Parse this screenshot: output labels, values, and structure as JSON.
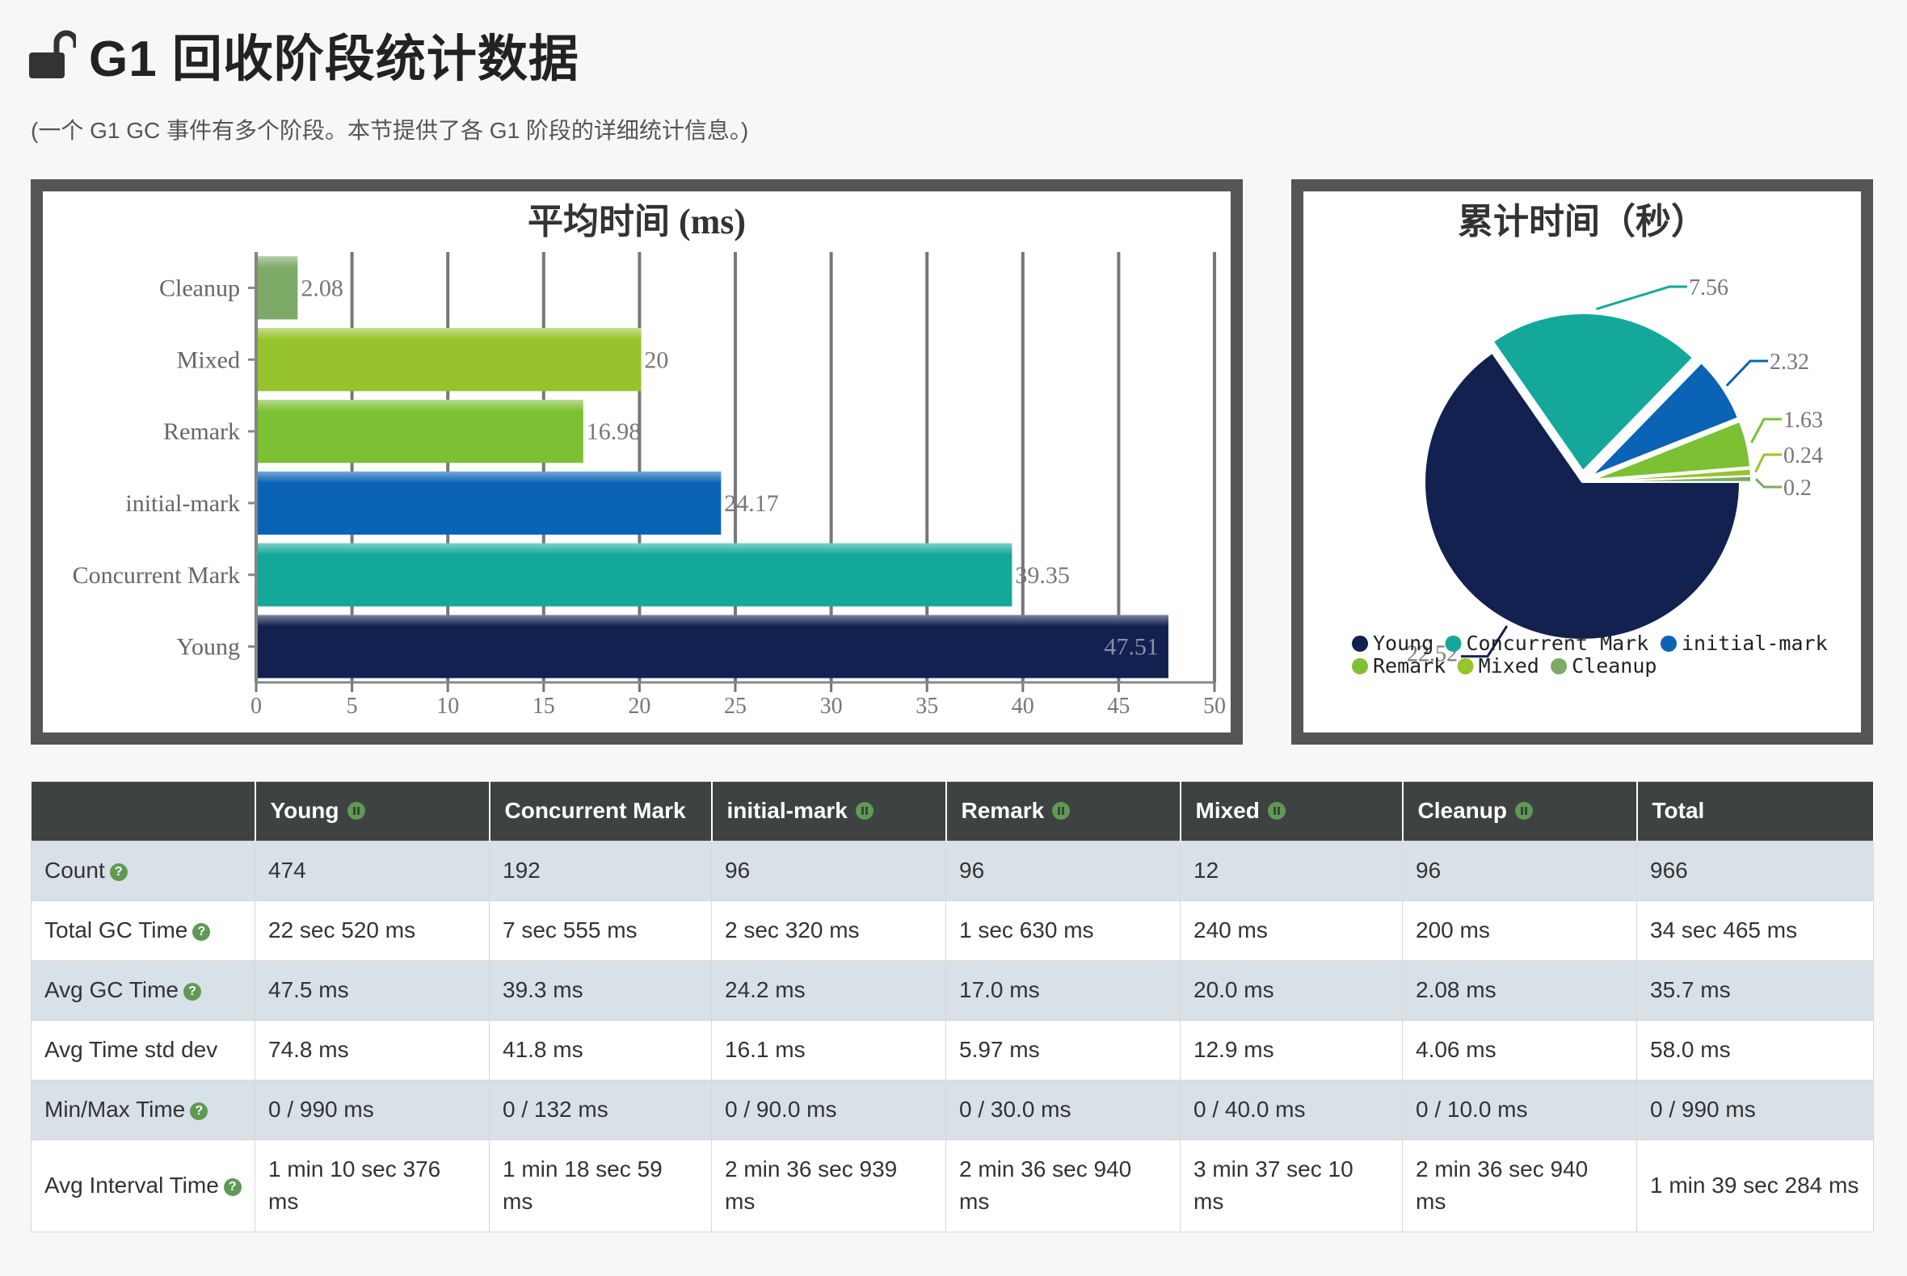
{
  "header": {
    "title": "G1 回收阶段统计数据",
    "subtitle": "(一个 G1 GC 事件有多个阶段。本节提供了各 G1 阶段的详细统计信息。)",
    "icon": "unlock-icon"
  },
  "colors": {
    "young": "#12214f",
    "concurrent_mark": "#14a89b",
    "initial_mark": "#0a63b5",
    "remark": "#7cc034",
    "mixed": "#97c42c",
    "cleanup": "#7daa66",
    "panel_border": "#555555",
    "table_header": "#3e4243"
  },
  "chart_data": [
    {
      "type": "bar",
      "orientation": "horizontal",
      "title": "平均时间 (ms)",
      "categories": [
        "Cleanup",
        "Mixed",
        "Remark",
        "initial-mark",
        "Concurrent Mark",
        "Young"
      ],
      "values": [
        2.08,
        20,
        16.98,
        24.17,
        39.35,
        47.51
      ],
      "value_labels": [
        "2.08",
        "20",
        "16.98",
        "24.17",
        "39.35",
        "47.51"
      ],
      "xlim": [
        0,
        50
      ],
      "xticks": [
        0,
        5,
        10,
        15,
        20,
        25,
        30,
        35,
        40,
        45,
        50
      ],
      "grid": true
    },
    {
      "type": "pie",
      "title": "累计时间（秒）",
      "labels": [
        "Young",
        "Concurrent Mark",
        "initial-mark",
        "Remark",
        "Mixed",
        "Cleanup"
      ],
      "values": [
        22.52,
        7.56,
        2.32,
        1.63,
        0.24,
        0.2
      ],
      "value_labels": [
        "22.52",
        "7.56",
        "2.32",
        "1.63",
        "0.24",
        "0.2"
      ],
      "legend_position": "bottom"
    }
  ],
  "table": {
    "columns": [
      {
        "label": "",
        "icon": ""
      },
      {
        "label": "Young",
        "icon": "pause-icon"
      },
      {
        "label": "Concurrent Mark",
        "icon": ""
      },
      {
        "label": "initial-mark",
        "icon": "pause-icon"
      },
      {
        "label": "Remark",
        "icon": "pause-icon"
      },
      {
        "label": "Mixed",
        "icon": "pause-icon"
      },
      {
        "label": "Cleanup",
        "icon": "pause-icon"
      },
      {
        "label": "Total",
        "icon": ""
      }
    ],
    "rows": [
      {
        "label": "Count",
        "help": true,
        "cells": [
          "474",
          "192",
          "96",
          "96",
          "12",
          "96",
          "966"
        ]
      },
      {
        "label": "Total GC Time",
        "help": true,
        "cells": [
          "22 sec 520 ms",
          "7 sec 555 ms",
          "2 sec 320 ms",
          "1 sec 630 ms",
          "240 ms",
          "200 ms",
          "34 sec 465 ms"
        ]
      },
      {
        "label": "Avg GC Time",
        "help": true,
        "cells": [
          "47.5 ms",
          "39.3 ms",
          "24.2 ms",
          "17.0 ms",
          "20.0 ms",
          "2.08 ms",
          "35.7 ms"
        ]
      },
      {
        "label": "Avg Time std dev",
        "help": false,
        "cells": [
          "74.8 ms",
          "41.8 ms",
          "16.1 ms",
          "5.97 ms",
          "12.9 ms",
          "4.06 ms",
          "58.0 ms"
        ]
      },
      {
        "label": "Min/Max Time",
        "help": true,
        "cells": [
          "0 / 990 ms",
          "0 / 132 ms",
          "0 / 90.0 ms",
          "0 / 30.0 ms",
          "0 / 40.0 ms",
          "0 / 10.0 ms",
          "0 / 990 ms"
        ]
      },
      {
        "label": "Avg Interval Time",
        "help": true,
        "cells": [
          "1 min 10 sec 376 ms",
          "1 min 18 sec 59 ms",
          "2 min 36 sec 939 ms",
          "2 min 36 sec 940 ms",
          "3 min 37 sec 10 ms",
          "2 min 36 sec 940 ms",
          "1 min 39 sec 284 ms"
        ]
      }
    ]
  }
}
